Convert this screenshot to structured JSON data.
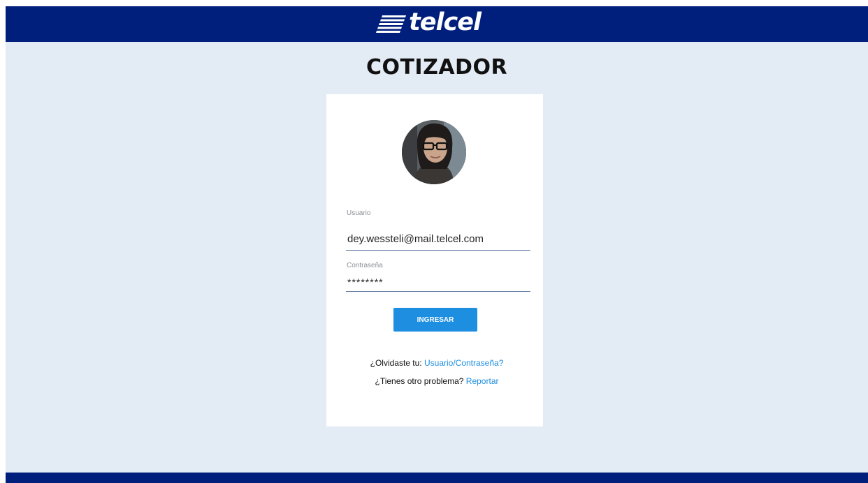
{
  "brand": {
    "logo_text": "telcel",
    "header_color": "#001e7b",
    "accent_color": "#1d8ee0",
    "background_color": "#e3ebf4"
  },
  "page": {
    "title": "COTIZADOR"
  },
  "login": {
    "avatar_icon": "user-photo",
    "username_label": "Usuario",
    "username_value": "dey.wessteli@mail.telcel.com",
    "password_label": "Contraseña",
    "password_value": "********",
    "submit_label": "INGRESAR",
    "forgot_prefix": "¿Olvidaste tu:",
    "forgot_link": "Usuario/Contraseña?",
    "problem_prefix": "¿Tienes otro problema?",
    "problem_link": "Reportar"
  }
}
